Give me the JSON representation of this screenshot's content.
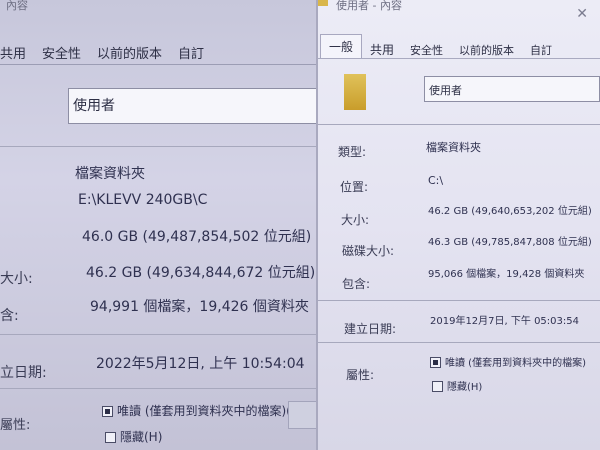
{
  "left_window": {
    "title_fragment": "內容",
    "tabs": [
      "共用",
      "安全性",
      "以前的版本",
      "自訂"
    ],
    "name_value": "使用者",
    "type_value": "檔案資料夾",
    "location_value": "E:\\KLEVV 240GB\\C",
    "size_value": "46.0 GB (49,487,854,502 位元組)",
    "size_on_disk_label": "大小:",
    "size_on_disk_value": "46.2 GB (49,634,844,672 位元組)",
    "contains_label": "含:",
    "contains_value": "94,991 個檔案，19,426 個資料夾",
    "created_label": "立日期:",
    "created_value": "2022年5月12日, 上午 10:54:04",
    "attributes_label": "屬性:",
    "readonly_label": "唯讀 (僅套用到資料夾中的檔案)(R)",
    "hidden_label": "隱藏(H)"
  },
  "right_window": {
    "title": "使用者 - 內容",
    "tabs": [
      "一般",
      "共用",
      "安全性",
      "以前的版本",
      "自訂"
    ],
    "name_value": "使用者",
    "type_label": "類型:",
    "type_value": "檔案資料夾",
    "location_label": "位置:",
    "location_value": "C:\\",
    "size_label": "大小:",
    "size_value": "46.2 GB (49,640,653,202 位元組)",
    "size_on_disk_label": "磁碟大小:",
    "size_on_disk_value": "46.3 GB (49,785,847,808 位元組)",
    "contains_label": "包含:",
    "contains_value": "95,066 個檔案，19,428 個資料夾",
    "created_label": "建立日期:",
    "created_value": "2019年12月7日, 下午 05:03:54",
    "attributes_label": "屬性:",
    "readonly_label": "唯讀 (僅套用到資料夾中的檔案)",
    "hidden_label": "隱藏(H)"
  }
}
